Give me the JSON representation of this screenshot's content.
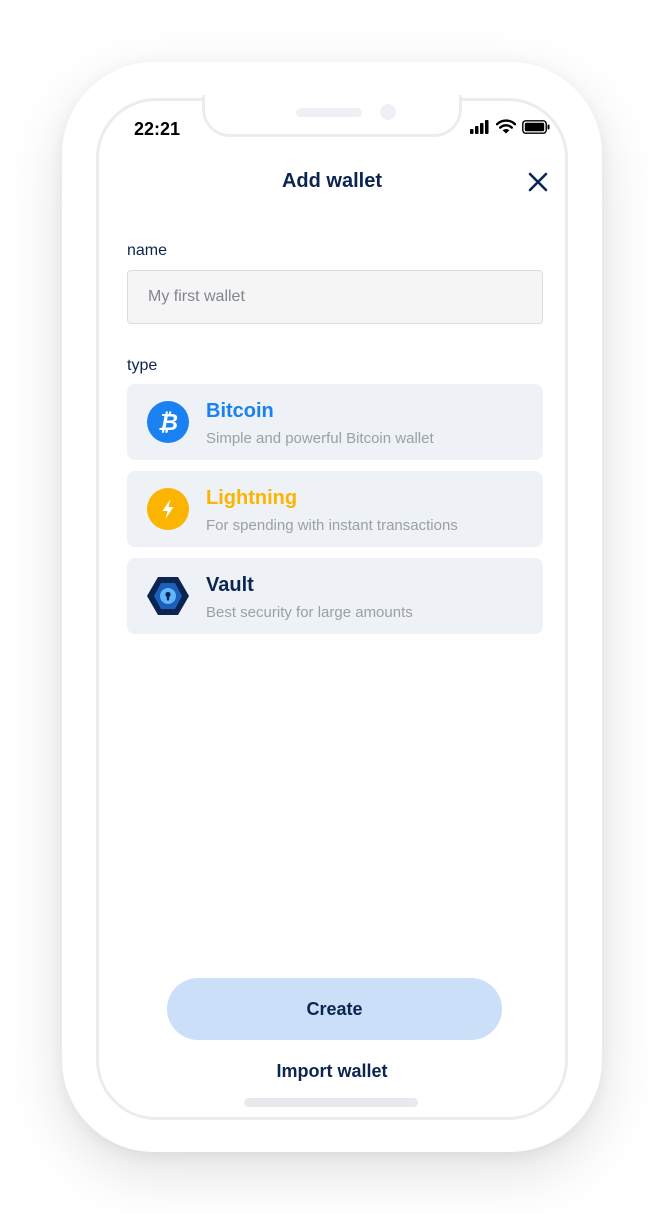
{
  "status_bar": {
    "time": "22:21"
  },
  "header": {
    "title": "Add wallet",
    "close_icon": "close-icon"
  },
  "form": {
    "name_label": "name",
    "name_placeholder": "My first wallet",
    "name_value": "",
    "type_label": "type"
  },
  "wallet_types": [
    {
      "title": "Bitcoin",
      "description": "Simple and powerful Bitcoin wallet",
      "icon": "bitcoin-icon",
      "color": "#1a82f0"
    },
    {
      "title": "Lightning",
      "description": "For spending with instant transactions",
      "icon": "lightning-icon",
      "color": "#fbb400"
    },
    {
      "title": "Vault",
      "description": "Best security for large amounts",
      "icon": "vault-icon",
      "color": "#0c2550"
    }
  ],
  "actions": {
    "create_label": "Create",
    "import_label": "Import wallet"
  },
  "colors": {
    "accent": "#0c2550",
    "button_bg": "#ccdff9",
    "card_bg": "#eef1f6"
  }
}
